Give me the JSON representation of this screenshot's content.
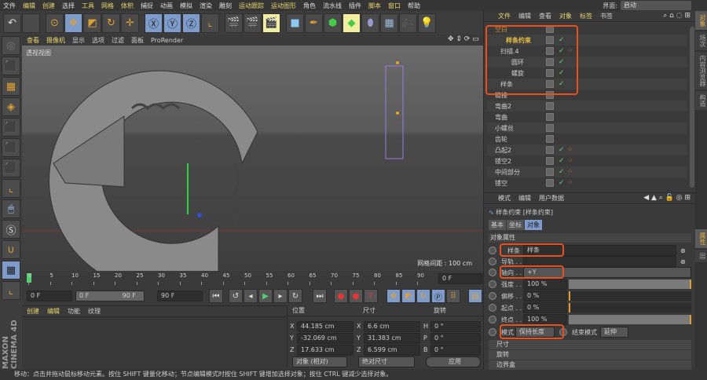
{
  "menu": [
    "文件",
    "编辑",
    "创建",
    "选择",
    "工具",
    "网格",
    "体积",
    "捕捉",
    "动画",
    "模拟",
    "渲染",
    "雕刻",
    "运动跟踪",
    "运动图形",
    "角色",
    "流水线",
    "插件",
    "脚本",
    "窗口",
    "帮助"
  ],
  "layout": {
    "label": "界面:",
    "value": "启动"
  },
  "viewport": {
    "menu": [
      "查看",
      "摄像机",
      "显示",
      "选项",
      "过滤",
      "面板",
      "ProRender"
    ],
    "name": "透视视图",
    "grid_spacing": "网格间距 : 100 cm"
  },
  "timeline": {
    "ticks": [
      "0",
      "5",
      "10",
      "15",
      "20",
      "25",
      "30",
      "35",
      "40",
      "45",
      "50",
      "55",
      "60",
      "65",
      "70",
      "75",
      "80",
      "85",
      "90"
    ],
    "current_frame": "0 F",
    "start": "0 F",
    "range_start": "0 F",
    "range_end": "90 F",
    "end": "90 F"
  },
  "materials": {
    "menu": [
      "创建",
      "编辑",
      "功能",
      "纹理"
    ]
  },
  "coords": {
    "headers": [
      "位置",
      "尺寸",
      "旋转"
    ],
    "rows": [
      {
        "a": "X",
        "pos": "44.185 cm",
        "b": "X",
        "size": "6.6 cm",
        "c": "H",
        "rot": "0 °"
      },
      {
        "a": "Y",
        "pos": "-32.069 cm",
        "b": "Y",
        "size": "31.383 cm",
        "c": "P",
        "rot": "0 °"
      },
      {
        "a": "Z",
        "pos": "17.633 cm",
        "b": "Z",
        "size": "6.599 cm",
        "c": "B",
        "rot": "0 °"
      }
    ],
    "mode": "对象 (相对)",
    "size_mode": "绝对尺寸",
    "apply": "应用"
  },
  "status": "移动：点击并拖动鼠标移动元素。按住 SHIFT 键量化移动；节点编辑模式时按住 SHIFT 键增加选择对象；按住 CTRL 键减少选择对象。",
  "objects": {
    "menu": [
      "文件",
      "编辑",
      "查看",
      "对象",
      "标签",
      "书签"
    ],
    "items": [
      {
        "name": "空白",
        "indent": 0,
        "check": false,
        "tag": false
      },
      {
        "name": "样条约束",
        "indent": 2,
        "check": true,
        "tag": false
      },
      {
        "name": "扫描.4",
        "indent": 1,
        "check": true,
        "tag": true
      },
      {
        "name": "圆环",
        "indent": 3,
        "check": true,
        "tag": false
      },
      {
        "name": "螺旋",
        "indent": 3,
        "check": true,
        "tag": false
      },
      {
        "name": "样条",
        "indent": 1,
        "check": true,
        "tag": false
      },
      {
        "name": "链接",
        "indent": 0,
        "check": false,
        "tag": false
      },
      {
        "name": "弯曲2",
        "indent": 0,
        "check": false,
        "tag": false
      },
      {
        "name": "弯曲",
        "indent": 0,
        "check": false,
        "tag": false
      },
      {
        "name": "小螺丝",
        "indent": 0,
        "check": false,
        "tag": false
      },
      {
        "name": "齿轮",
        "indent": 0,
        "check": false,
        "tag": false
      },
      {
        "name": "凸起2",
        "indent": 0,
        "check": true,
        "tag": true
      },
      {
        "name": "镂空2",
        "indent": 0,
        "check": true,
        "tag": true
      },
      {
        "name": "中间部分",
        "indent": 0,
        "check": true,
        "tag": true
      },
      {
        "name": "镂空",
        "indent": 0,
        "check": true,
        "tag": true
      }
    ]
  },
  "side_tabs_top": [
    "对象",
    "场次",
    "内容浏览器",
    "构造"
  ],
  "side_tabs_bottom": [
    "属性",
    "层"
  ],
  "attributes": {
    "menu": [
      "模式",
      "编辑",
      "用户数据"
    ],
    "title": "样条约束 [样条约束]",
    "tabs": [
      "基本",
      "坐标",
      "对象"
    ],
    "section": "对象属性",
    "spline_label": "样条",
    "spline_value": "样条",
    "rail_label": "导轨 . .",
    "axis_label": "轴向 . .",
    "axis_value": "+Y",
    "sliders": [
      {
        "label": "强度 . .",
        "value": "100 %",
        "fraction": 1
      },
      {
        "label": "偏移 . .",
        "value": "0 %",
        "fraction": 0
      },
      {
        "label": "起点 . .",
        "value": "0 %",
        "fraction": 0
      },
      {
        "label": "终点 . .",
        "value": "100 %",
        "fraction": 1
      }
    ],
    "mode_label": "模式",
    "mode_value": "保持长度",
    "end_mode_label": "结束模式",
    "end_mode_value": "延伸",
    "groups": [
      "尺寸",
      "旋转",
      "边界盒"
    ]
  },
  "colors": {
    "accent": "#e8d36a",
    "highlight_box": "#e8501e",
    "selected_tab": "#7d9ccc"
  }
}
